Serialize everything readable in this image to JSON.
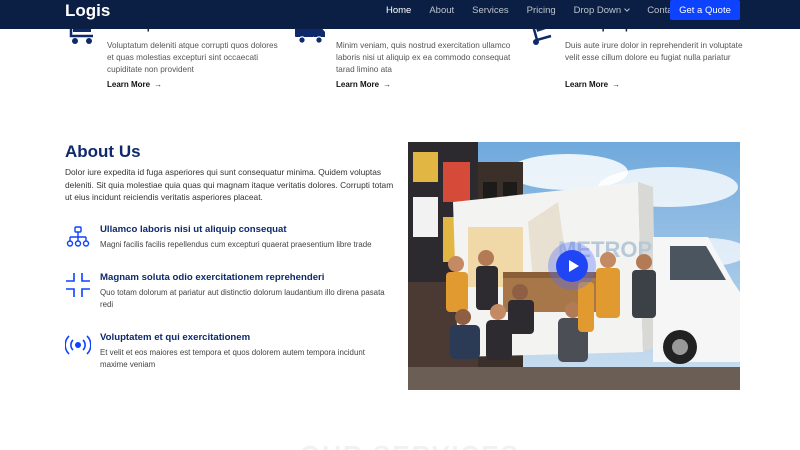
{
  "header": {
    "logo": "Logis",
    "nav": [
      {
        "label": "Home",
        "active": true
      },
      {
        "label": "About"
      },
      {
        "label": "Services"
      },
      {
        "label": "Pricing"
      },
      {
        "label": "Drop Down",
        "dropdown": true
      },
      {
        "label": "Contact"
      }
    ],
    "cta": "Get a Quote"
  },
  "features": [
    {
      "icon": "cart-flatbed-icon",
      "title": "Lorem Ipsum",
      "text": "Voluptatum deleniti atque corrupti quos dolores et quas molestias excepturi sint occaecati cupiditate non provident",
      "link": "Learn More"
    },
    {
      "icon": "truck-icon",
      "title": "Dolor Sitema",
      "text": "Minim veniam, quis nostrud exercitation ullamco laboris nisi ut aliquip ex ea commodo consequat tarad limino ata",
      "link": "Learn More"
    },
    {
      "icon": "hand-truck-icon",
      "title": "Sed ut perspiciatis",
      "text": "Duis aute irure dolor in reprehenderit in voluptate velit esse cillum dolore eu fugiat nulla pariatur",
      "link": "Learn More"
    }
  ],
  "about": {
    "title": "About Us",
    "text": "Dolor iure expedita id fuga asperiores qui sunt consequatur minima. Quidem voluptas deleniti. Sit quia molestiae quia quas qui magnam itaque veritatis dolores. Corrupti totam ut eius incidunt reiciendis veritatis asperiores placeat.",
    "items": [
      {
        "icon": "diagram-icon",
        "title": "Ullamco laboris nisi ut aliquip consequat",
        "text": "Magni facilis facilis repellendus cum excepturi quaerat praesentium libre trade"
      },
      {
        "icon": "fullscreen-exit-icon",
        "title": "Magnam soluta odio exercitationem reprehenderi",
        "text": "Quo totam dolorum at pariatur aut distinctio dolorum laudantium illo direna pasata redi"
      },
      {
        "icon": "broadcast-icon",
        "title": "Voluptatem et qui exercitationem",
        "text": "Et velit et eos maiores est tempora et quos dolorem autem tempora incidunt maxime veniam"
      }
    ],
    "photo_truck_text": "METROPOLIS"
  },
  "next_section_heading": "OUR SERVICES",
  "colors": {
    "header_bg": "#0b1f44",
    "accent": "#0d42ff",
    "heading": "#0e2a6b",
    "feature_icon": "#0e2a6b"
  }
}
